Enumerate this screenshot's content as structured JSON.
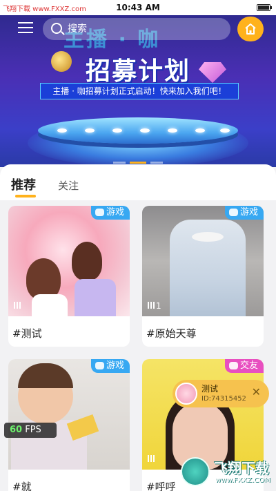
{
  "status_bar": {
    "site_watermark": "飞翔下载 www.FXXZ.com",
    "time": "10:43 AM"
  },
  "header": {
    "search_placeholder": "搜索",
    "search_value": ""
  },
  "banner": {
    "title": "招募计划",
    "ghost_title": "主播 · 咖",
    "slogan": "主播 · 咖招募计划正式启动！快来加入我们吧！",
    "page_count": 3,
    "active_page": 2
  },
  "tabs": [
    {
      "label": "推荐",
      "active": true
    },
    {
      "label": "关注",
      "active": false
    }
  ],
  "cards": [
    {
      "title": "#测试",
      "tag": "游戏",
      "tag_color": "#37a8f2",
      "viewers": ""
    },
    {
      "title": "#原始天尊",
      "tag": "游戏",
      "tag_color": "#37a8f2",
      "viewers": "1"
    },
    {
      "title": "#就",
      "tag": "游戏",
      "tag_color": "#37a8f2",
      "viewers": ""
    },
    {
      "title": "#呼呼",
      "tag": "交友",
      "tag_color": "#e84fc0",
      "viewers": ""
    }
  ],
  "overlay": {
    "fps_value": "60",
    "fps_unit": "FPS",
    "mini_player": {
      "name": "测试",
      "uid": "ID:74315452",
      "close": "✕"
    },
    "watermark": {
      "brand": "飞翔下载",
      "url": "www.FXXZ.COM"
    }
  },
  "colors": {
    "accent": "#ffb21c",
    "tag_game": "#37a8f2",
    "tag_social": "#e84fc0"
  }
}
